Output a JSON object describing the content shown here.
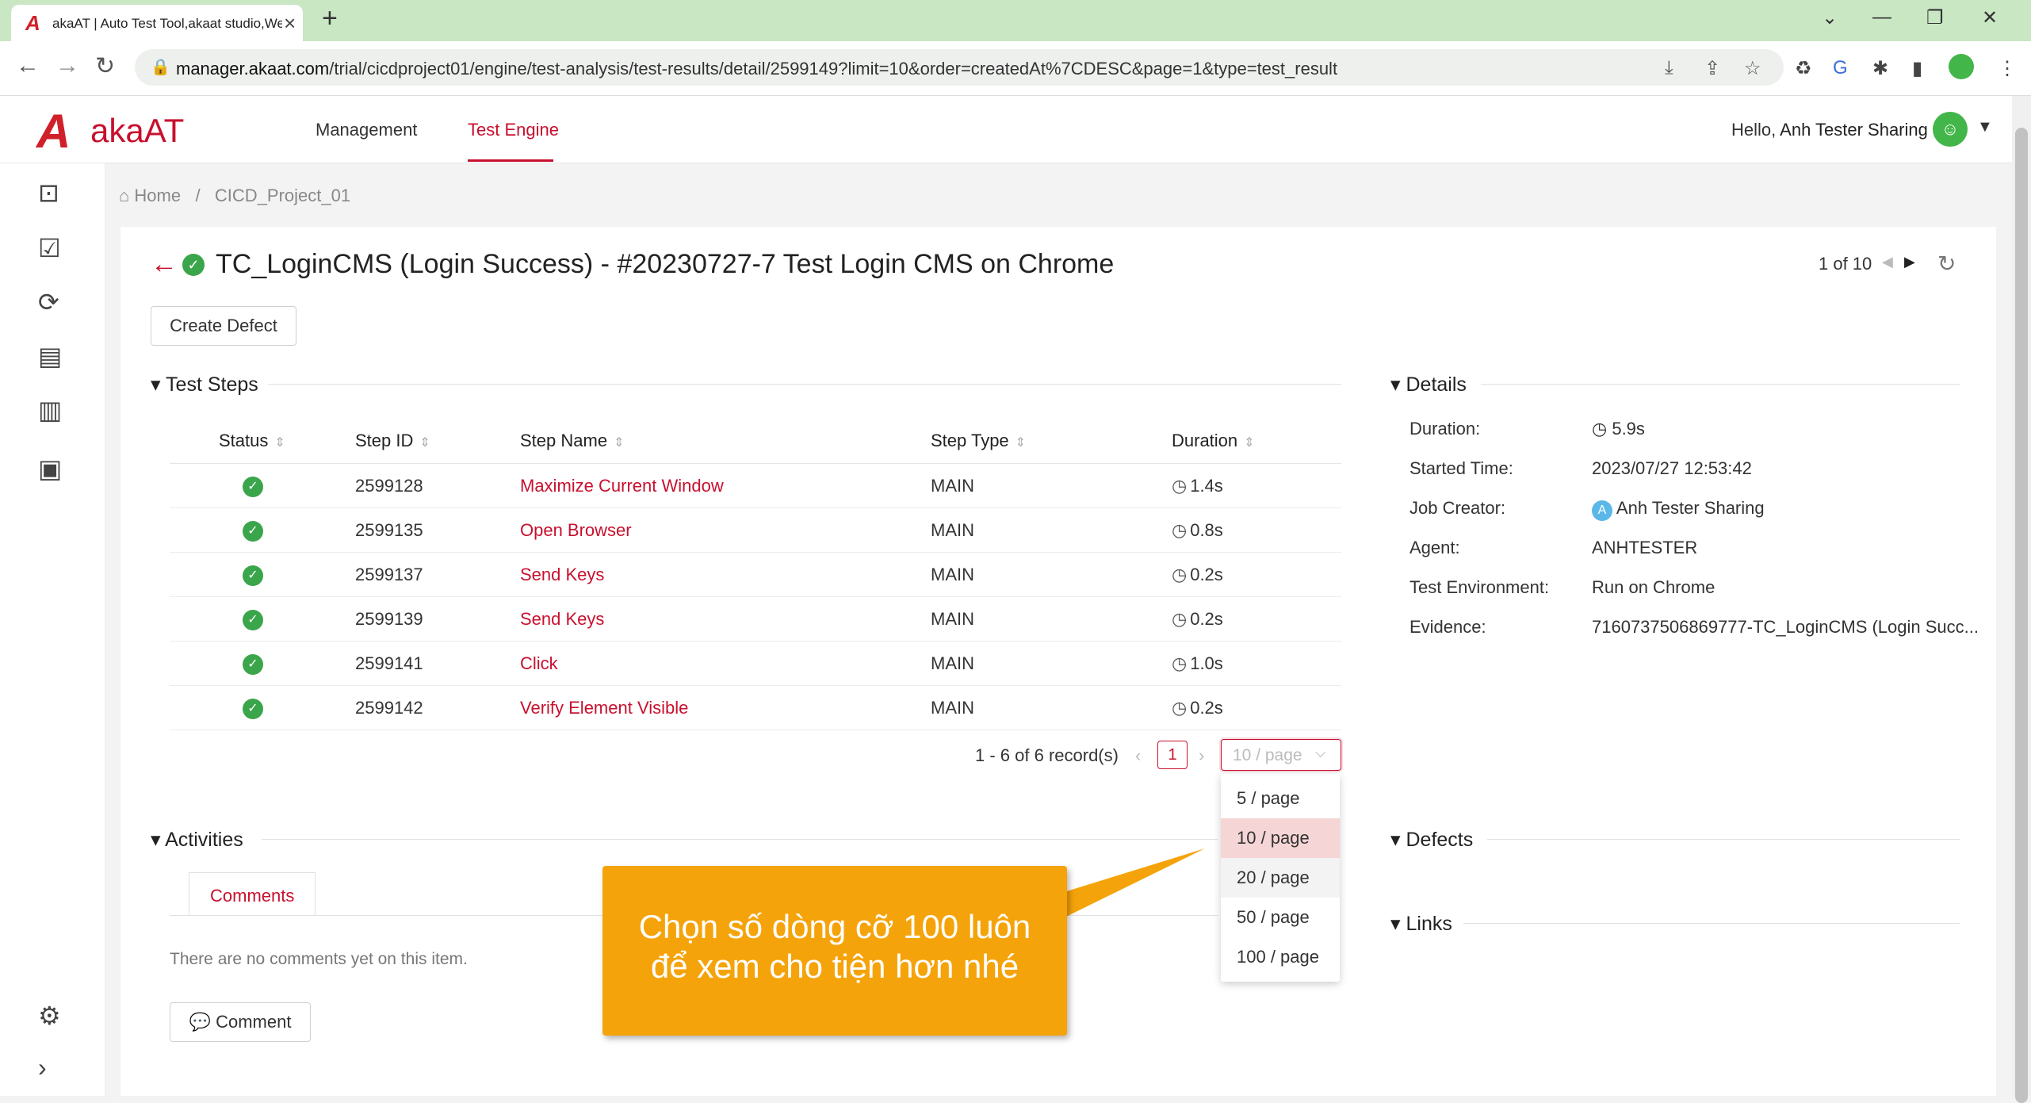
{
  "browser": {
    "tab_title": "akaAT | Auto Test Tool,akaat studio,Web",
    "url_prefix": "manager.akaat.com",
    "url_rest": "/trial/cicdproject01/engine/test-analysis/test-results/detail/2599149?limit=10&order=createdAt%7CDESC&page=1&type=test_result"
  },
  "app": {
    "logo_text": "akaAT",
    "nav": [
      "Management",
      "Test Engine"
    ],
    "hello": "Hello,",
    "user": "Anh Tester Sharing"
  },
  "breadcrumb": {
    "home": "Home",
    "sep": "/",
    "project": "CICD_Project_01"
  },
  "page": {
    "title": "TC_LoginCMS (Login Success) - #20230727-7 Test Login CMS on Chrome",
    "pager": "1 of 10",
    "create_defect": "Create Defect"
  },
  "steps": {
    "section_title": "Test Steps",
    "headers": [
      "Status",
      "Step ID",
      "Step Name",
      "Step Type",
      "Duration"
    ],
    "rows": [
      {
        "id": "2599128",
        "name": "Maximize Current Window",
        "type": "MAIN",
        "duration": "1.4s"
      },
      {
        "id": "2599135",
        "name": "Open Browser",
        "type": "MAIN",
        "duration": "0.8s"
      },
      {
        "id": "2599137",
        "name": "Send Keys",
        "type": "MAIN",
        "duration": "0.2s"
      },
      {
        "id": "2599139",
        "name": "Send Keys",
        "type": "MAIN",
        "duration": "0.2s"
      },
      {
        "id": "2599141",
        "name": "Click",
        "type": "MAIN",
        "duration": "1.0s"
      },
      {
        "id": "2599142",
        "name": "Verify Element Visible",
        "type": "MAIN",
        "duration": "0.2s"
      }
    ],
    "records": "1 - 6 of 6 record(s)",
    "current_page": "1",
    "page_size": "10 / page",
    "page_size_options": [
      "5 / page",
      "10 / page",
      "20 / page",
      "50 / page",
      "100 / page"
    ]
  },
  "details": {
    "section_title": "Details",
    "items": [
      {
        "label": "Duration",
        "value": "5.9s"
      },
      {
        "label": "Started Time",
        "value": "2023/07/27 12:53:42"
      },
      {
        "label": "Job Creator",
        "value": "Anh Tester Sharing"
      },
      {
        "label": "Agent",
        "value": "ANHTESTER"
      },
      {
        "label": "Test Environment",
        "value": "Run on Chrome"
      },
      {
        "label": "Evidence",
        "value": "7160737506869777-TC_LoginCMS (Login Succ..."
      }
    ],
    "creator_initial": "A"
  },
  "activities": {
    "section_title": "Activities",
    "tab": "Comments",
    "empty": "There are no comments yet on this item.",
    "comment_button": "Comment"
  },
  "defects": {
    "section_title": "Defects"
  },
  "links": {
    "section_title": "Links"
  },
  "callout": {
    "line1": "Chọn số dòng cỡ 100 luôn",
    "line2": "để xem cho tiện hơn nhé"
  },
  "colors": {
    "brand": "#c8102e",
    "success": "#3aa54a",
    "callout": "#f5a30a",
    "tabbar": "#c9e7c3"
  }
}
